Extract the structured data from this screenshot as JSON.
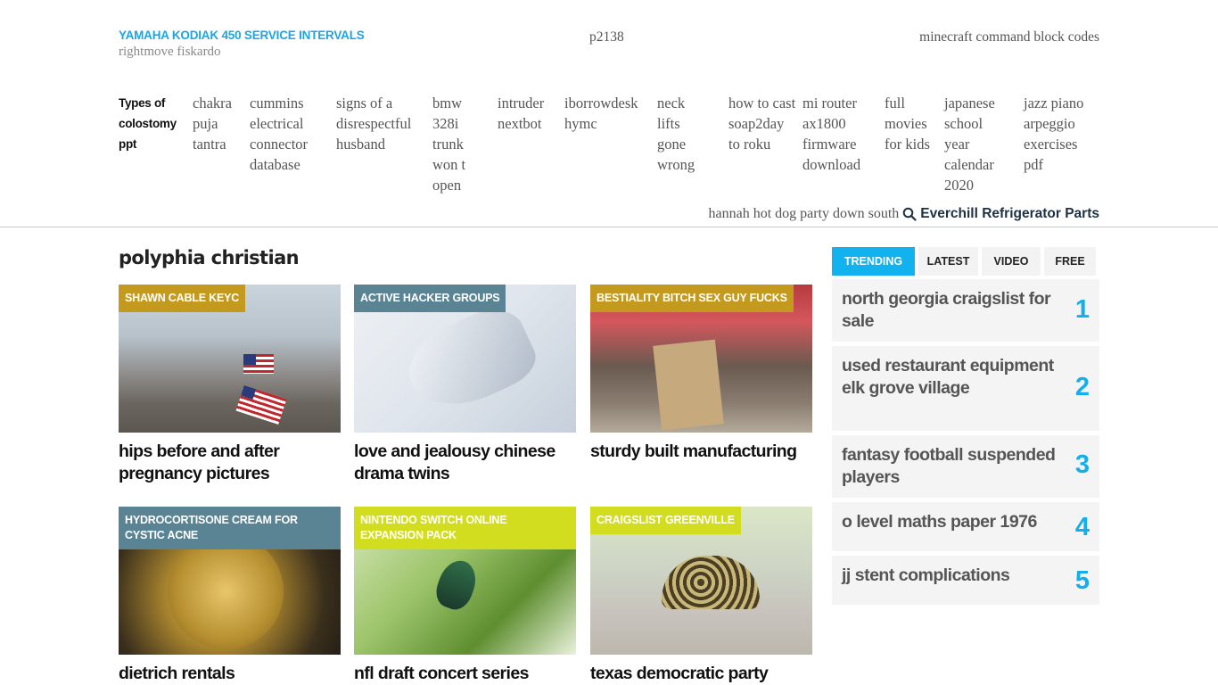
{
  "header": {
    "site_title": "YAMAHA KODIAK 450 SERVICE INTERVALS",
    "site_subtitle": "rightmove fiskardo",
    "center_link": "p2138",
    "right_link": "minecraft command block codes"
  },
  "nav": {
    "label": "Types of colostomy ppt",
    "items": [
      "chakra puja tantra",
      "cummins electrical connector database",
      "signs of a disrespectful husband",
      "bmw 328i trunk won t open",
      "intruder nextbot",
      "iborrowdesk hymc",
      "neck lifts gone wrong",
      "how to cast soap2day to roku",
      "mi router ax1800 firmware download",
      "full movies for kids",
      "japanese school year calendar 2020",
      "jazz piano arpeggio exercises pdf"
    ]
  },
  "search": {
    "text": "hannah hot dog party down south",
    "icon": "search-icon",
    "brand": "Everchill Refrigerator Parts"
  },
  "section": {
    "title": "polyphia christian"
  },
  "cards": [
    {
      "tag": "SHAWN CABLE KEYC",
      "tag_color": "#c49a1e",
      "title": "hips before and after pregnancy pictures",
      "image": "refinery-with-flags"
    },
    {
      "tag": "ACTIVE HACKER GROUPS",
      "tag_color": "#5a8494",
      "title": "love and jealousy chinese drama twins",
      "image": "robot-hand"
    },
    {
      "tag": "BESTIALITY BITCH SEX GUY FUCKS",
      "tag_color": "#c49a1e",
      "title": "sturdy built manufacturing",
      "image": "climate-protest-sign"
    },
    {
      "tag": "HYDROCORTISONE CREAM FOR CYSTIC ACNE",
      "tag_color": "#5a8494",
      "title": "dietrich rentals",
      "image": "bitcoin-coin"
    },
    {
      "tag": "NINTENDO SWITCH ONLINE EXPANSION PACK",
      "tag_color": "#d3dd1f",
      "title": "nfl draft concert series",
      "image": "hummingbird"
    },
    {
      "tag": "CRAIGSLIST GREENVILLE",
      "tag_color": "#d3dd1f",
      "title": "texas democratic party",
      "image": "tortoise"
    }
  ],
  "sidebar": {
    "tabs": [
      "TRENDING",
      "LATEST",
      "VIDEO",
      "FREE"
    ],
    "active_tab": "TRENDING",
    "trending": [
      {
        "rank": "1",
        "title": "north georgia craigslist for sale"
      },
      {
        "rank": "2",
        "title": "used restaurant equipment elk grove village"
      },
      {
        "rank": "3",
        "title": "fantasy football suspended players"
      },
      {
        "rank": "4",
        "title": "o level maths paper 1976"
      },
      {
        "rank": "5",
        "title": "jj stent complications"
      }
    ]
  },
  "colors": {
    "accent": "#14aeea",
    "title_blue": "#1ba6e0",
    "tag_gold": "#c49a1e",
    "tag_slate": "#5a8494",
    "tag_lime": "#d3dd1f"
  }
}
